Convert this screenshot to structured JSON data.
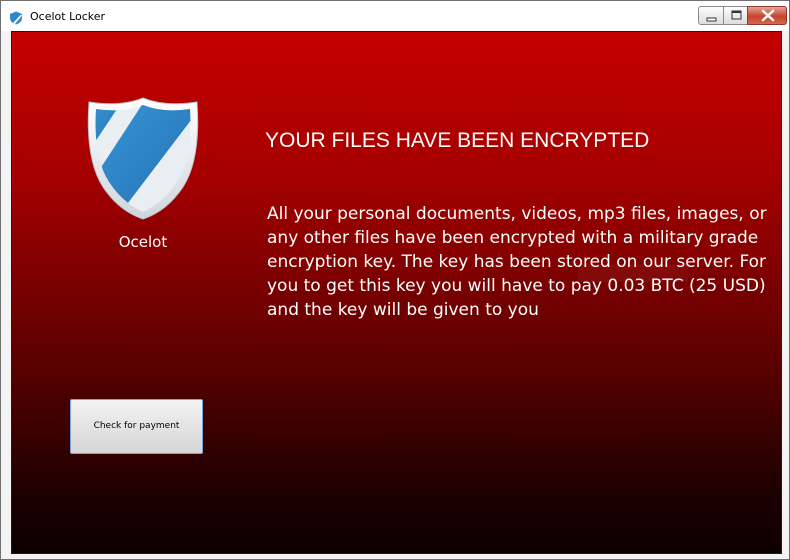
{
  "window": {
    "title": "Ocelot Locker",
    "controls": {
      "minimize_icon": "minimize-icon",
      "maximize_icon": "maximize-icon",
      "close_icon": "close-icon"
    }
  },
  "brand": {
    "name": "Ocelot",
    "logo_icon": "shield-icon"
  },
  "notice": {
    "headline": "YOUR FILES HAVE BEEN ENCRYPTED",
    "body": "All your personal documents, videos, mp3 files, images, or any other files have been encrypted with a military grade encryption key. The key has been stored on our server. For you to get this key you will have to pay 0.03 BTC (25 USD) and the key will be given to you"
  },
  "actions": {
    "check_payment_label": "Check for payment"
  },
  "colors": {
    "background_top": "#c50000",
    "background_bottom": "#0d0000",
    "text": "#ffffff",
    "shield_blue": "#2f86c8",
    "close_button": "#c4452d"
  }
}
